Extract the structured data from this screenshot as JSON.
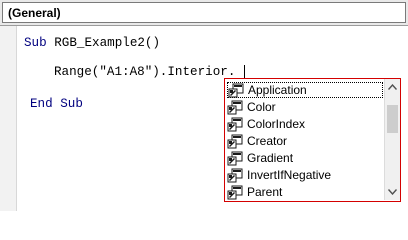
{
  "module_combo": {
    "selected": "(General)"
  },
  "code": {
    "line1_kw": "Sub",
    "line1_rest": " RGB_Example2()",
    "line2": "Range(\"A1:A8\").Interior.",
    "line3": "End Sub"
  },
  "intellisense": {
    "items": [
      {
        "label": "Application",
        "icon": "property-icon",
        "selected": true
      },
      {
        "label": "Color",
        "icon": "property-icon"
      },
      {
        "label": "ColorIndex",
        "icon": "property-icon"
      },
      {
        "label": "Creator",
        "icon": "property-icon"
      },
      {
        "label": "Gradient",
        "icon": "property-icon"
      },
      {
        "label": "InvertIfNegative",
        "icon": "property-icon"
      },
      {
        "label": "Parent",
        "icon": "property-icon"
      }
    ]
  }
}
